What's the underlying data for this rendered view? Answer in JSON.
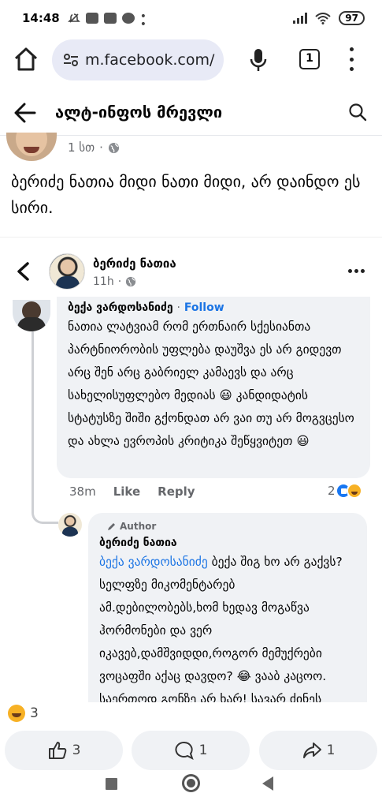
{
  "status_bar": {
    "time": "14:48",
    "battery": "97"
  },
  "browser": {
    "url": "m.facebook.com/",
    "tab_count": "1"
  },
  "group_header": {
    "title": "ალტ-ინფოს მრევლი"
  },
  "post1": {
    "time": "1 სთ",
    "text": "ბერიძე ნათია მიდი ნათი მიდი,  არ დაინდო ეს სირი."
  },
  "comment_overlay": {
    "author": "ბერიძე ნათია",
    "time": "11h"
  },
  "comment1": {
    "author": "ბექა ვარდოსანიძე",
    "separator": "·",
    "follow_label": "Follow",
    "text": "ნათია ლატვიამ რომ ერთნაირ სქესიანთა პარტნიორობის უფლება დაუშვა ეს არ გიდევთ არც შენ არც გაბრიელ კამაევს და არც სახელისუფლებო მედიას 😃 კანდიდატის სტატუსზე შიში გქონდათ არ ვაი თუ არ მოგვცესო და ახლა ევროპის კრიტიკა შეწყვიტეთ 😃",
    "time": "38m",
    "like_label": "Like",
    "reply_label": "Reply",
    "reaction_count": "2"
  },
  "comment2": {
    "badge": "Author",
    "author": "ბერიძე ნათია",
    "mention": "ბექა ვარდოსანიძე",
    "text": " ბექა შიგ ხო არ გაქვს? სელფზე მიკომენტარებ ამ.დებილობებს,ხომ ხედავ მოგაწვა ჰორმონები და ვერ იკავებ,დამშვიდდი,როგორ მემუქრები ვოცაფში აქაც დავდო? 😂 ვააბ კაცოო. საერთოდ გონზე არ ხარ! სავარ ძინეს დაწერეთ და დადე"
  },
  "post_reactions": {
    "count": "3"
  },
  "action_bar": {
    "likes": "3",
    "comments": "1",
    "shares": "1"
  }
}
